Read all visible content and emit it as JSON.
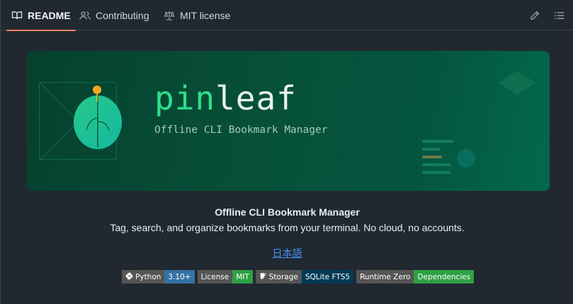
{
  "tabs": [
    {
      "label": "README",
      "icon": "book-icon",
      "active": true
    },
    {
      "label": "Contributing",
      "icon": "people-icon",
      "active": false
    },
    {
      "label": "MIT license",
      "icon": "scale-icon",
      "active": false
    }
  ],
  "toolbar": {
    "edit_icon": "pencil-icon",
    "outline_icon": "list-icon"
  },
  "banner": {
    "title_part1": "pin",
    "title_part2": "leaf",
    "subtitle": "Offline CLI Bookmark Manager"
  },
  "description": {
    "title": "Offline CLI Bookmark Manager",
    "body": "Tag, search, and organize bookmarks from your terminal. No cloud, no accounts."
  },
  "language_link": "日本語",
  "badges": [
    {
      "label": "Python",
      "value": "3.10+",
      "color": "#3572a5",
      "icon": "python-icon"
    },
    {
      "label": "License",
      "value": "MIT",
      "color": "#2ea043"
    },
    {
      "label": "Storage",
      "value": "SQLite FTS5",
      "color": "#003b57",
      "icon": "sqlite-icon"
    },
    {
      "label": "Runtime Zero",
      "value": "Dependencies",
      "color": "#2ea043"
    }
  ],
  "colors": {
    "accent": "#f78166",
    "brand_green": "#2ee08c",
    "link": "#4493f8"
  }
}
